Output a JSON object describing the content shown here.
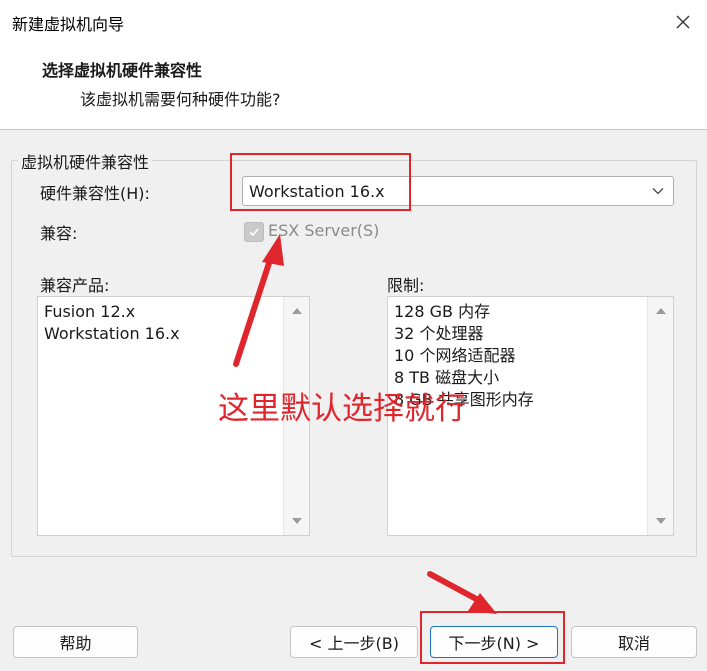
{
  "window": {
    "title": "新建虚拟机向导"
  },
  "header": {
    "title": "选择虚拟机硬件兼容性",
    "subtitle": "该虚拟机需要何种硬件功能?"
  },
  "group": {
    "legend": "虚拟机硬件兼容性",
    "compat_label": "硬件兼容性(H):",
    "compat_value": "Workstation 16.x",
    "compatible_label": "兼容:",
    "esx_checkbox": {
      "label": "ESX Server(S)",
      "checked": true,
      "disabled": true
    },
    "products_label": "兼容产品:",
    "products": [
      "Fusion 12.x",
      "Workstation 16.x"
    ],
    "limits_label": "限制:",
    "limits": [
      "128 GB 内存",
      "32 个处理器",
      "10 个网络适配器",
      "8 TB 磁盘大小",
      "8 GB 共享图形内存"
    ]
  },
  "buttons": {
    "help": "帮助",
    "back": "< 上一步(B)",
    "next": "下一步(N) >",
    "cancel": "取消"
  },
  "annotation": {
    "text": "这里默认选择就行"
  },
  "colors": {
    "annotation": "#e0262d",
    "primary_border": "#1a73c8"
  }
}
